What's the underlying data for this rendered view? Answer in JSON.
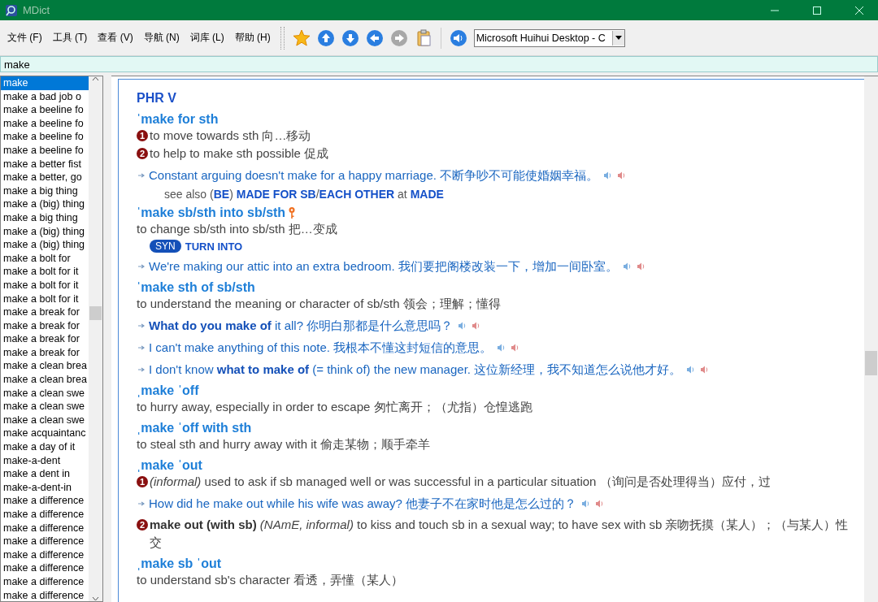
{
  "window": {
    "title": "MDict"
  },
  "menu": [
    "文件 (F)",
    "工具 (T)",
    "查看 (V)",
    "导航 (N)",
    "词库 (L)",
    "帮助 (H)"
  ],
  "nav_buttons": [
    {
      "kind": "up",
      "disabled": false
    },
    {
      "kind": "down",
      "disabled": false
    },
    {
      "kind": "back",
      "disabled": false
    },
    {
      "kind": "forward",
      "disabled": true
    }
  ],
  "voice": {
    "value": "Microsoft Huihui Desktop - C"
  },
  "search": {
    "value": "make"
  },
  "word_list": [
    {
      "text": "make",
      "selected": true
    },
    {
      "text": "make a bad job o",
      "selected": false
    },
    {
      "text": "make a beeline fo",
      "selected": false
    },
    {
      "text": "make a beeline fo",
      "selected": false
    },
    {
      "text": "make a beeline fo",
      "selected": false
    },
    {
      "text": "make a beeline fo",
      "selected": false
    },
    {
      "text": "make a better fist",
      "selected": false
    },
    {
      "text": "make a better, go",
      "selected": false
    },
    {
      "text": "make a big thing",
      "selected": false
    },
    {
      "text": "make a (big) thing",
      "selected": false
    },
    {
      "text": "make a big thing",
      "selected": false
    },
    {
      "text": "make a (big) thing",
      "selected": false
    },
    {
      "text": "make a (big) thing",
      "selected": false
    },
    {
      "text": "make a bolt for",
      "selected": false
    },
    {
      "text": "make a bolt for it",
      "selected": false
    },
    {
      "text": "make a bolt for it",
      "selected": false
    },
    {
      "text": "make a bolt for it",
      "selected": false
    },
    {
      "text": "make a break for",
      "selected": false
    },
    {
      "text": "make a break for",
      "selected": false
    },
    {
      "text": "make a break for",
      "selected": false
    },
    {
      "text": "make a break for",
      "selected": false
    },
    {
      "text": "make a clean brea",
      "selected": false
    },
    {
      "text": "make a clean brea",
      "selected": false
    },
    {
      "text": "make a clean swe",
      "selected": false
    },
    {
      "text": "make a clean swe",
      "selected": false
    },
    {
      "text": "make a clean swe",
      "selected": false
    },
    {
      "text": "make acquaintanc",
      "selected": false
    },
    {
      "text": "make a day of it",
      "selected": false
    },
    {
      "text": "make-a-dent",
      "selected": false
    },
    {
      "text": "make a dent in",
      "selected": false
    },
    {
      "text": "make-a-dent-in",
      "selected": false
    },
    {
      "text": "make a difference",
      "selected": false
    },
    {
      "text": "make a difference",
      "selected": false
    },
    {
      "text": "make a difference",
      "selected": false
    },
    {
      "text": "make a difference",
      "selected": false
    },
    {
      "text": "make a difference",
      "selected": false
    },
    {
      "text": "make a difference",
      "selected": false
    },
    {
      "text": "make a difference",
      "selected": false
    },
    {
      "text": "make a difference",
      "selected": false
    }
  ],
  "entry": {
    "blocks": [
      {
        "kind": "heading",
        "text": "PHR V"
      },
      {
        "kind": "phrase",
        "text": "ˈmake for sth"
      },
      {
        "kind": "sense",
        "number": "1",
        "text": "to move towards sth 向…移动"
      },
      {
        "kind": "sense",
        "number": "2",
        "text": "to help to make sth possible 促成"
      },
      {
        "kind": "example",
        "text": "Constant arguing doesn't make for a happy marriage. 不断争吵不可能使婚姻幸福。"
      },
      {
        "kind": "see_also",
        "text": "see also (**BE**) **MADE FOR SB**/**EACH OTHER** at **MADE**"
      },
      {
        "kind": "phrase",
        "text": "ˈmake sb/sth into sb/sth",
        "key": true
      },
      {
        "kind": "sense",
        "text": "to change sb/sth into sb/sth 把…变成"
      },
      {
        "kind": "syn",
        "label": "SYN",
        "text": "TURN INTO"
      },
      {
        "kind": "example",
        "text": "We're making our attic into an extra bedroom. 我们要把阁楼改装一下，增加一间卧室。"
      },
      {
        "kind": "phrase",
        "text": "ˈmake sth of sb/sth"
      },
      {
        "kind": "sense",
        "text": "to understand the meaning or character of sb/sth 领会；理解；懂得"
      },
      {
        "kind": "example",
        "text": "**What do you make of** it all? 你明白那都是什么意思吗？"
      },
      {
        "kind": "example",
        "text": "I can't make anything of this note. 我根本不懂这封短信的意思。"
      },
      {
        "kind": "example",
        "text": "I don't know **what to make of** (= think of) the new manager. 这位新经理，我不知道怎么说他才好。"
      },
      {
        "kind": "phrase",
        "text": "ˌmake ˈoff"
      },
      {
        "kind": "sense",
        "text": "to hurry away, especially in order to escape 匆忙离开；（尤指）仓惶逃跑"
      },
      {
        "kind": "phrase",
        "text": "ˌmake ˈoff with sth"
      },
      {
        "kind": "sense",
        "text": "to steal sth and hurry away with it 偷走某物；顺手牵羊"
      },
      {
        "kind": "phrase",
        "text": "ˌmake ˈout"
      },
      {
        "kind": "sense",
        "number": "1",
        "text": "*(informal)* used to ask if sb managed well or was successful in a particular situation （询问是否处理得当）应付，过"
      },
      {
        "kind": "example",
        "text": "How did he make out while his wife was away? 他妻子不在家时他是怎么过的？"
      },
      {
        "kind": "sense",
        "number": "2",
        "text": "**make out (with sb)** *(NAmE, informal)* to kiss and touch sb in a sexual way; to have sex with sb 亲吻抚摸（某人）；（与某人）性交"
      },
      {
        "kind": "phrase",
        "text": "ˌmake sb ˈout"
      },
      {
        "kind": "sense",
        "text": "to understand sb's character 看透，弄懂（某人）"
      }
    ]
  }
}
